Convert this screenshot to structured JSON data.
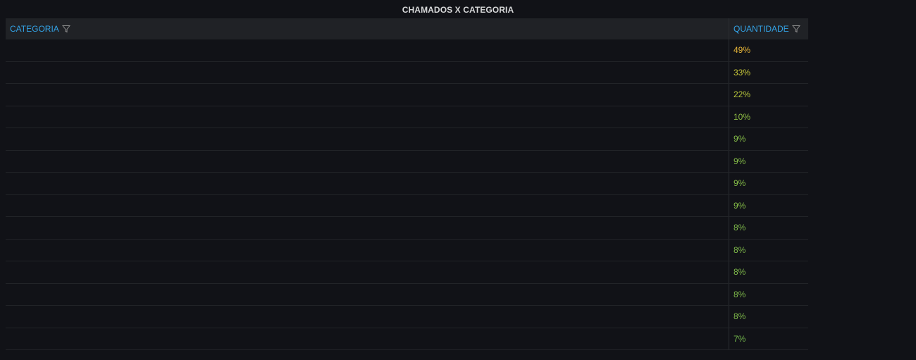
{
  "panel": {
    "title": "CHAMADOS X CATEGORIA"
  },
  "table": {
    "columns": [
      {
        "label": "CATEGORIA",
        "icon": "filter-icon"
      },
      {
        "label": "QUANTIDADE",
        "icon": "filter-icon"
      }
    ],
    "rows": [
      {
        "categoria": "",
        "quantidade": "49%",
        "color": "#eab839"
      },
      {
        "categoria": "",
        "quantidade": "33%",
        "color": "#c8c83a"
      },
      {
        "categoria": "",
        "quantidade": "22%",
        "color": "#b5c43c"
      },
      {
        "categoria": "",
        "quantidade": "10%",
        "color": "#8fbe44"
      },
      {
        "categoria": "",
        "quantidade": "9%",
        "color": "#85bd48"
      },
      {
        "categoria": "",
        "quantidade": "9%",
        "color": "#85bd48"
      },
      {
        "categoria": "",
        "quantidade": "9%",
        "color": "#85bd48"
      },
      {
        "categoria": "",
        "quantidade": "9%",
        "color": "#85bd48"
      },
      {
        "categoria": "",
        "quantidade": "8%",
        "color": "#7eb94a"
      },
      {
        "categoria": "",
        "quantidade": "8%",
        "color": "#7eb94a"
      },
      {
        "categoria": "",
        "quantidade": "8%",
        "color": "#7eb94a"
      },
      {
        "categoria": "",
        "quantidade": "8%",
        "color": "#7eb94a"
      },
      {
        "categoria": "",
        "quantidade": "8%",
        "color": "#7eb94a"
      },
      {
        "categoria": "",
        "quantidade": "7%",
        "color": "#73b84c"
      }
    ]
  }
}
